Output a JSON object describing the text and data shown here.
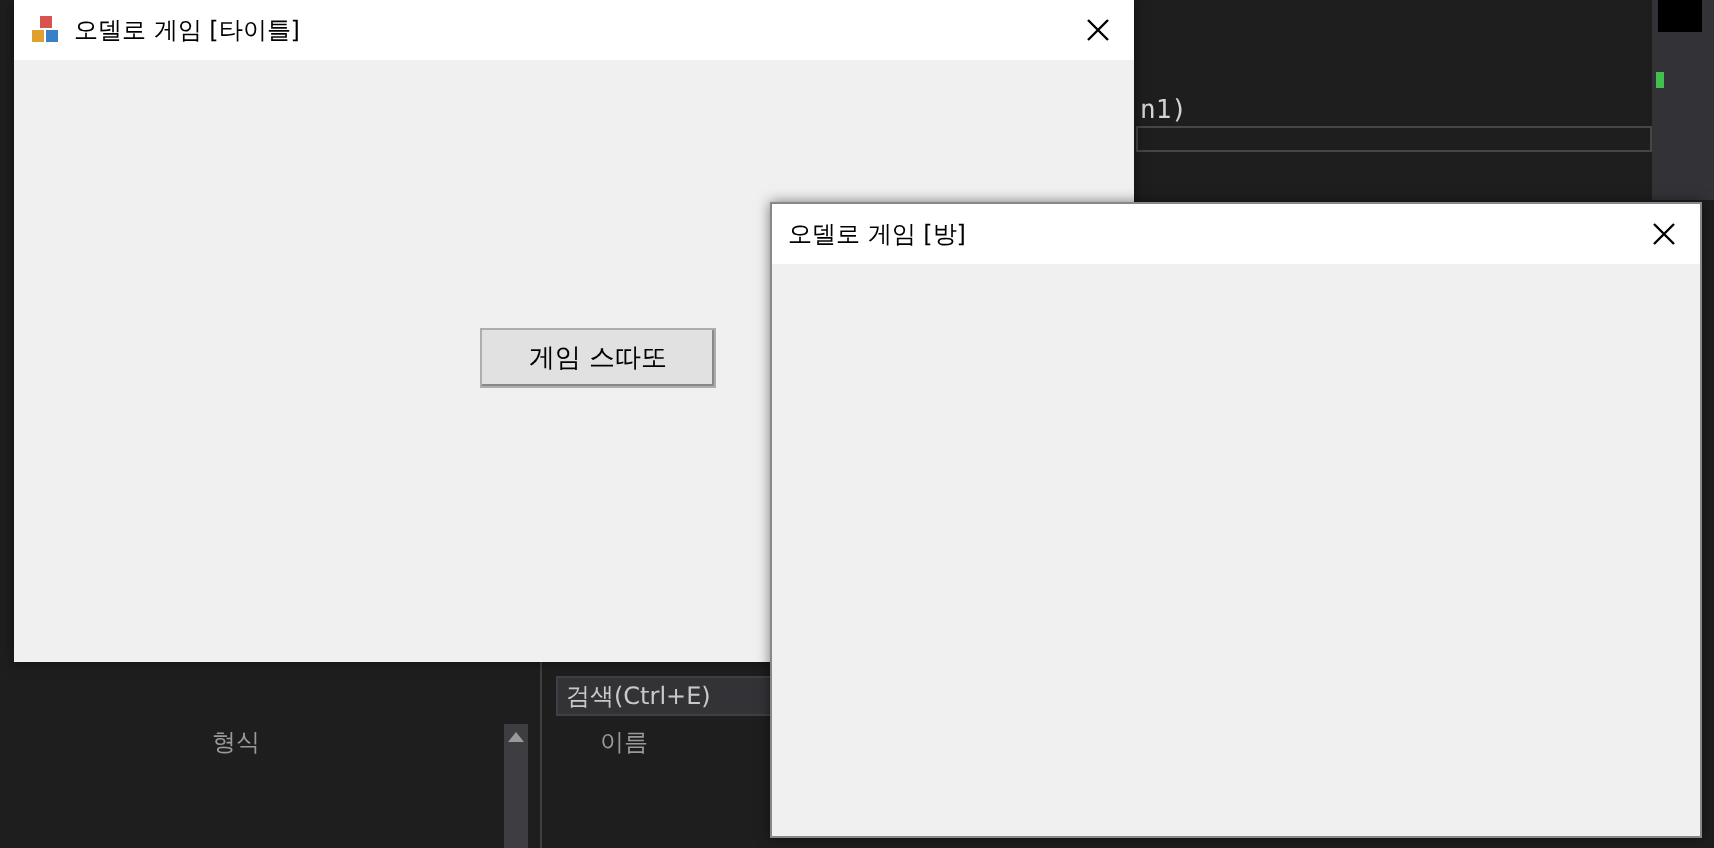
{
  "editor": {
    "code_fragment": "n1)"
  },
  "bottom_panels": {
    "left_column": "형식",
    "search": {
      "placeholder": "검색(Ctrl+E)"
    },
    "right_column": "이름"
  },
  "windows": [
    {
      "title": "오델로 게임 [타이틀]",
      "has_icon": true,
      "button": "게임 스따또"
    },
    {
      "title": "오델로 게임 [방]",
      "has_icon": false
    }
  ]
}
